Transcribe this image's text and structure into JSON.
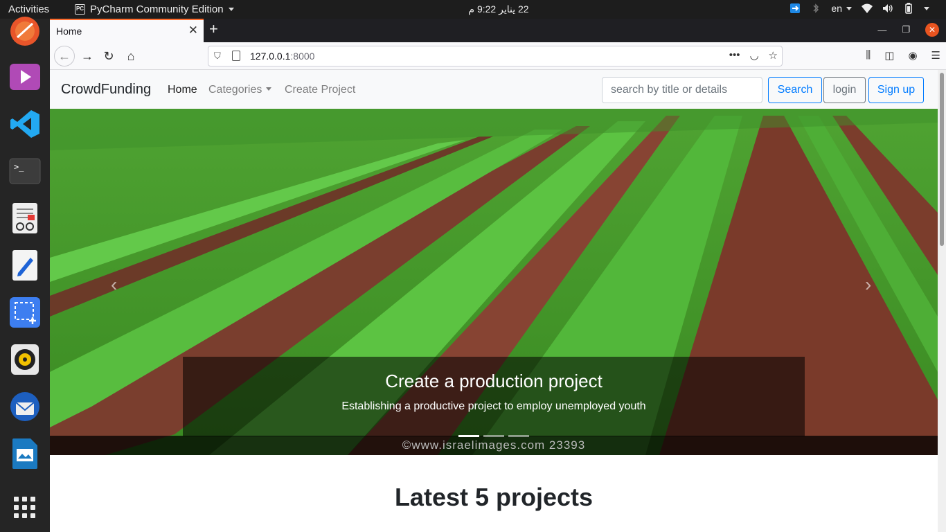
{
  "system": {
    "activities": "Activities",
    "app_name": "PyCharm Community Edition",
    "clock": "22 يناير  9:22 م",
    "lang": "en"
  },
  "browser": {
    "tab_title": "Home",
    "url_host": "127.0.0.1",
    "url_port": ":8000"
  },
  "site": {
    "brand": "CrowdFunding",
    "nav": {
      "home": "Home",
      "categories": "Categories",
      "create_project": "Create Project"
    },
    "search_placeholder": "search by title or details",
    "search_button": "Search",
    "login_button": "login",
    "signup_button": "Sign up"
  },
  "carousel": {
    "caption_title": "Create a production project",
    "caption_text": "Establishing a productive project to employ unemployed youth",
    "slide_count": 3,
    "active_index": 0,
    "image_watermark": "©www.israelimages.com  23393",
    "prev_icon": "chevron-left",
    "next_icon": "chevron-right"
  },
  "section": {
    "title": "Latest 5 projects"
  },
  "colors": {
    "accent": "#007bff",
    "secondary": "#6c757d",
    "ubuntu_orange": "#e95420"
  }
}
